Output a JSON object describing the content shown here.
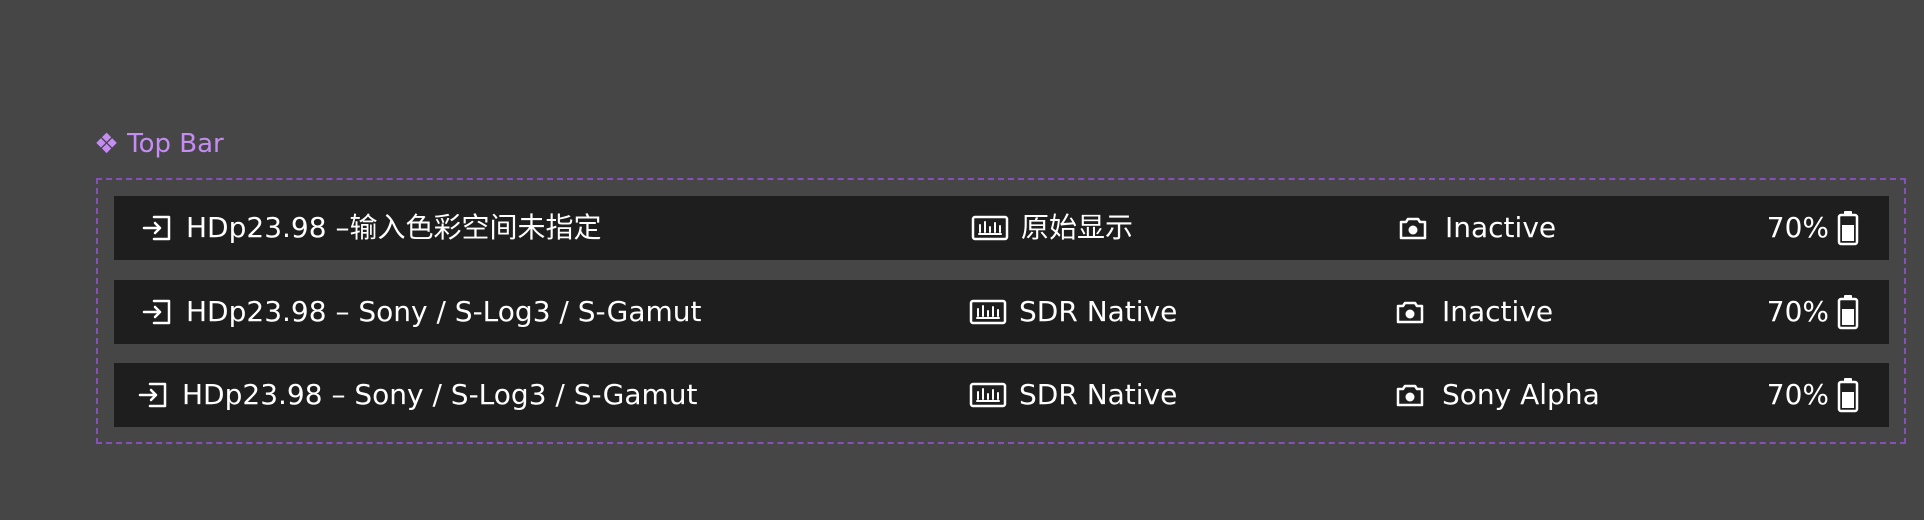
{
  "component": {
    "label": "Top Bar",
    "label_color": "#c58cf3",
    "frame_color": "#8650b9",
    "symbol": "❖"
  },
  "background": {
    "page": "#464646",
    "bar": "#1e1e1e"
  },
  "rows": [
    {
      "input_icon": "input-arrow-icon",
      "input_label": "HDp23.98 –输入色彩空间未指定",
      "display_icon": "display-meter-icon",
      "display_label": "原始显示",
      "camera_icon": "camera-icon",
      "camera_label": "Inactive",
      "battery_label": "70%",
      "battery_icon": "battery-icon"
    },
    {
      "input_icon": "input-arrow-icon",
      "input_label": "HDp23.98 – Sony / S-Log3 / S-Gamut",
      "display_icon": "display-meter-icon",
      "display_label": "SDR Native",
      "camera_icon": "camera-icon",
      "camera_label": "Inactive",
      "battery_label": "70%",
      "battery_icon": "battery-icon"
    },
    {
      "input_icon": "input-arrow-icon",
      "input_label": "HDp23.98 – Sony / S-Log3 / S-Gamut",
      "display_icon": "display-meter-icon",
      "display_label": "SDR Native",
      "camera_icon": "camera-icon",
      "camera_label": "Sony Alpha",
      "battery_label": "70%",
      "battery_icon": "battery-icon"
    }
  ]
}
